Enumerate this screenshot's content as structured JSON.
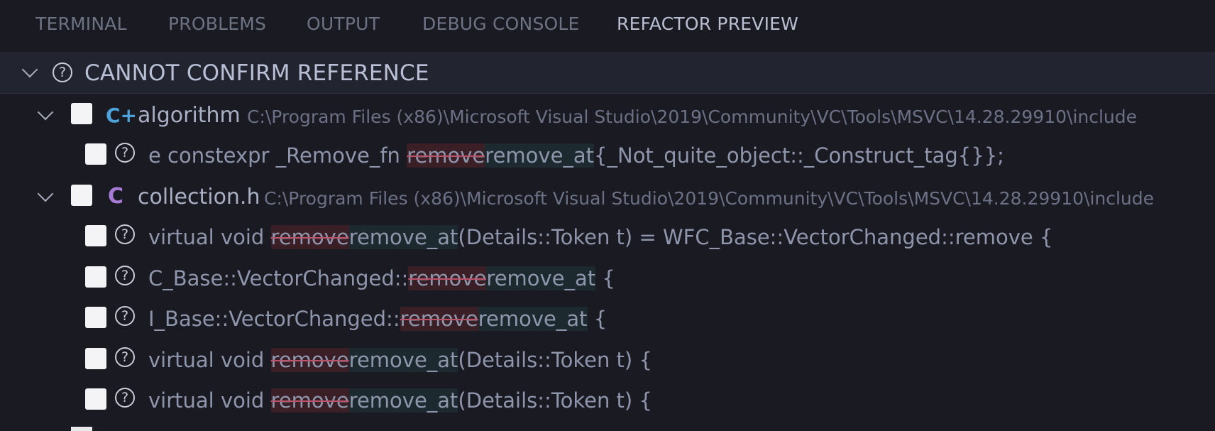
{
  "tabs": [
    {
      "label": "TERMINAL",
      "active": false
    },
    {
      "label": "PROBLEMS",
      "active": false
    },
    {
      "label": "OUTPUT",
      "active": false
    },
    {
      "label": "DEBUG CONSOLE",
      "active": false
    },
    {
      "label": "REFACTOR PREVIEW",
      "active": true
    }
  ],
  "section": {
    "title": "CANNOT CONFIRM REFERENCE",
    "icon": "question-circle-icon"
  },
  "files": [
    {
      "name": "algorithm",
      "icon": "cpp-icon",
      "icon_glyph": "C+",
      "path": "C:\\Program Files (x86)\\Microsoft Visual Studio\\2019\\Community\\VC\\Tools\\MSVC\\14.28.29910\\include",
      "lines": [
        {
          "before": "e constexpr _Remove_fn ",
          "removed": "remove",
          "added": "remove_at",
          "after": "{_Not_quite_object::_Construct_tag{}};"
        }
      ]
    },
    {
      "name": "collection.h",
      "icon": "c-header-icon",
      "icon_glyph": "C",
      "path": "C:\\Program Files (x86)\\Microsoft Visual Studio\\2019\\Community\\VC\\Tools\\MSVC\\14.28.29910\\include",
      "lines": [
        {
          "before": "virtual void ",
          "removed": "remove",
          "added": "remove_at",
          "after": "(Details::Token t) = WFC_Base::VectorChanged::remove {"
        },
        {
          "before": "C_Base::VectorChanged::",
          "removed": "remove",
          "added": "remove_at",
          "after": " {"
        },
        {
          "before": "I_Base::VectorChanged::",
          "removed": "remove",
          "added": "remove_at",
          "after": " {"
        },
        {
          "before": "virtual void ",
          "removed": "remove",
          "added": "remove_at",
          "after": "(Details::Token t) {"
        },
        {
          "before": "virtual void ",
          "removed": "remove",
          "added": "remove_at",
          "after": "(Details::Token t) {"
        }
      ]
    }
  ],
  "colors": {
    "background": "#191a22",
    "section_header": "#222430",
    "removed_bg": "#3a1f27",
    "added_bg": "#1c2a30",
    "cpp_icon": "#4da3d9",
    "c_icon": "#a77bd6"
  }
}
